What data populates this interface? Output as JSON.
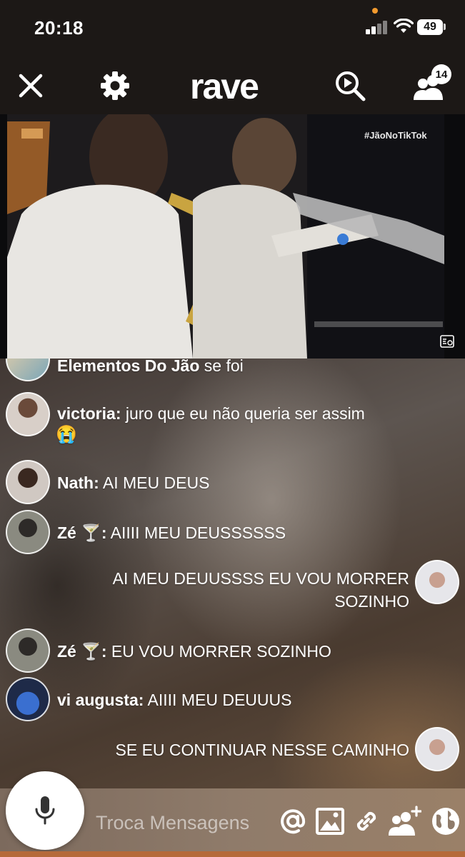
{
  "status_bar": {
    "time": "20:18",
    "battery": "49"
  },
  "nav": {
    "logo": "rave",
    "friends_count": "14"
  },
  "video": {
    "hashtag": "#JãoNoTikTok"
  },
  "chat": {
    "messages": [
      {
        "author": "Elementos Do Jão",
        "text": "se foi",
        "side": "left"
      },
      {
        "author": "victoria:",
        "text": "juro que eu não queria ser assim",
        "emoji": "😭",
        "side": "left"
      },
      {
        "author": "Nath:",
        "text": "AI MEU DEUS",
        "side": "left"
      },
      {
        "author": "Zé 🍸:",
        "text": "AIIII MEU DEUSSSSSS",
        "side": "left"
      },
      {
        "text_line1": "AI MEU DEUUSSSS EU VOU MORRER",
        "text_line2": "SOZINHO",
        "side": "right"
      },
      {
        "author": "Zé 🍸:",
        "text": "EU VOU MORRER SOZINHO",
        "side": "left"
      },
      {
        "author": "vi augusta:",
        "text": "AIIII MEU DEUUUS",
        "side": "left"
      },
      {
        "text": "SE EU CONTINUAR NESSE CAMINHO",
        "side": "right"
      }
    ]
  },
  "input": {
    "placeholder": "Troca Mensagens"
  },
  "colors": {
    "accent_orange": "#f29a2e",
    "nav_background": "#1c1816"
  }
}
